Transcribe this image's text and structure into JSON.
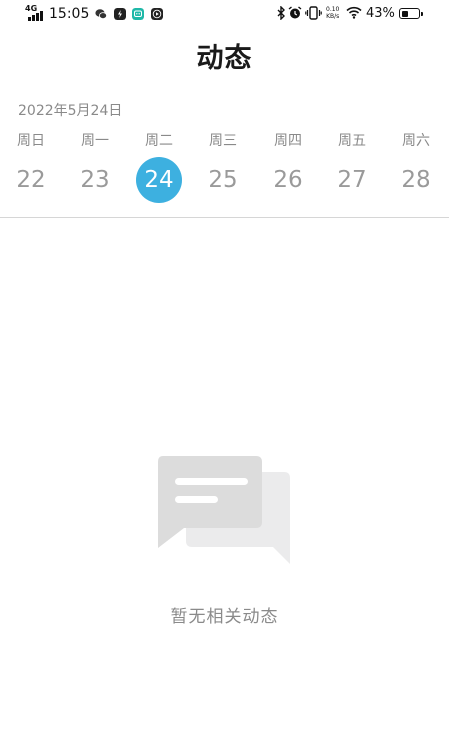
{
  "status_bar": {
    "network": "4G",
    "time": "15:05",
    "speed_value": "0.10",
    "speed_unit": "KB/s",
    "battery": "43%",
    "battery_level": 0.43
  },
  "header": {
    "title": "动态"
  },
  "calendar": {
    "date": "2022年5月24日",
    "days": [
      {
        "weekday": "周日",
        "num": "22"
      },
      {
        "weekday": "周一",
        "num": "23"
      },
      {
        "weekday": "周二",
        "num": "24"
      },
      {
        "weekday": "周三",
        "num": "25"
      },
      {
        "weekday": "周四",
        "num": "26"
      },
      {
        "weekday": "周五",
        "num": "27"
      },
      {
        "weekday": "周六",
        "num": "28"
      }
    ],
    "selected_num": "24"
  },
  "empty_state": {
    "icon": "chat-bubbles-icon",
    "text": "暂无相关动态"
  },
  "colors": {
    "accent": "#3db0e0",
    "muted_text": "#8a8a8a",
    "illustration_front": "#dcdcdc",
    "illustration_back": "#ebebec"
  }
}
